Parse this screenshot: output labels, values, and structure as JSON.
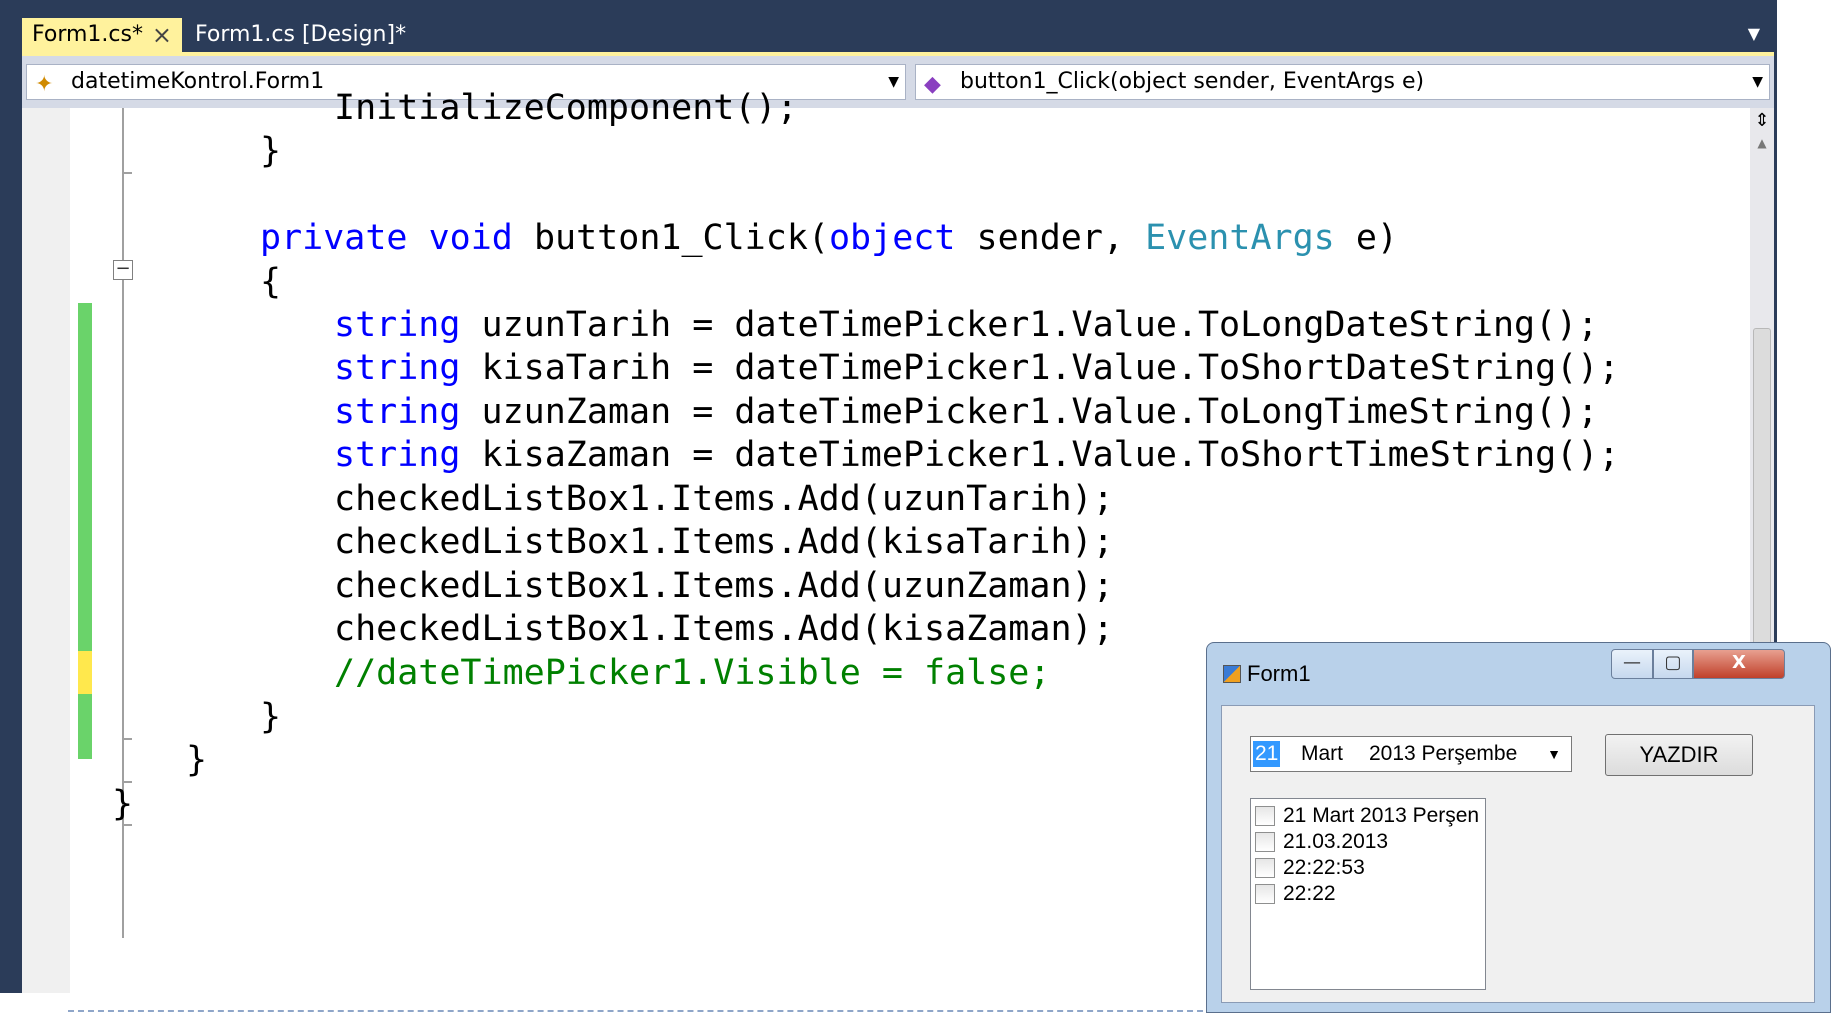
{
  "tabs": [
    {
      "label": "Form1.cs*",
      "active": true,
      "close_icon": "×"
    },
    {
      "label": "Form1.cs [Design]*",
      "active": false
    }
  ],
  "navbar": {
    "type_combo": "datetimeKontrol.Form1",
    "member_combo": "button1_Click(object sender, EventArgs e)"
  },
  "code": {
    "l1": "InitializeComponent();",
    "l2": "}",
    "l4_kw1": "private",
    "l4_kw2": "void",
    "l4_name": "button1_Click(",
    "l4_kw3": "object",
    "l4_sender": "sender,",
    "l4_type": "EventArgs",
    "l4_e": "e)",
    "l5": "{",
    "kw_string": "string",
    "l6_rest": "uzunTarih = dateTimePicker1.Value.ToLongDateString();",
    "l7_rest": "kisaTarih = dateTimePicker1.Value.ToShortDateString();",
    "l8_rest": "uzunZaman = dateTimePicker1.Value.ToLongTimeString();",
    "l9_rest": "kisaZaman = dateTimePicker1.Value.ToShortTimeString();",
    "l10": "checkedListBox1.Items.Add(uzunTarih);",
    "l11": "checkedListBox1.Items.Add(kisaTarih);",
    "l12": "checkedListBox1.Items.Add(uzunZaman);",
    "l13": "checkedListBox1.Items.Add(kisaZaman);",
    "l14": "//dateTimePicker1.Visible = false;",
    "l15": "}",
    "l16": "}",
    "l17": "}"
  },
  "form1": {
    "title": "Form1",
    "minimize": "—",
    "maximize": "▢",
    "close": "X",
    "datepicker": {
      "day": "21",
      "month": "Mart",
      "rest": "2013 Perşembe"
    },
    "button": "YAZDIR",
    "list_items": [
      "21 Mart 2013 Perşen",
      "21.03.2013",
      "22:22:53",
      "22:22"
    ]
  },
  "colors": {
    "keyword": "#0000ff",
    "type": "#2b91af",
    "comment": "#008000",
    "saved_change": "#6ad36a",
    "unsaved_change": "#ffe84d"
  }
}
